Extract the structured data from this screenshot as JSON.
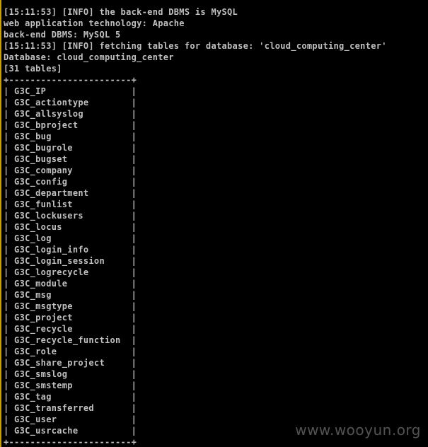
{
  "console": {
    "top_fragment": "---",
    "header_lines": [
      "[15:11:53] [INFO] the back-end DBMS is MySQL",
      "web application technology: Apache",
      "back-end DBMS: MySQL 5",
      "[15:11:53] [INFO] fetching tables for database: 'cloud_computing_center'",
      "Database: cloud_computing_center",
      "[31 tables]"
    ],
    "table_border": "+-----------------------+",
    "tables": [
      "| G3C_IP                |",
      "| G3C_actiontype        |",
      "| G3C_allsyslog         |",
      "| G3C_bproject          |",
      "| G3C_bug               |",
      "| G3C_bugrole           |",
      "| G3C_bugset            |",
      "| G3C_company           |",
      "| G3C_config            |",
      "| G3C_department        |",
      "| G3C_funlist           |",
      "| G3C_lockusers         |",
      "| G3C_locus             |",
      "| G3C_log               |",
      "| G3C_login_info        |",
      "| G3C_login_session     |",
      "| G3C_logrecycle        |",
      "| G3C_module            |",
      "| G3C_msg               |",
      "| G3C_msgtype           |",
      "| G3C_project           |",
      "| G3C_recycle           |",
      "| G3C_recycle_function  |",
      "| G3C_role              |",
      "| G3C_share_project     |",
      "| G3C_smslog            |",
      "| G3C_smstemp           |",
      "| G3C_tag               |",
      "| G3C_transferred       |",
      "| G3C_user              |",
      "| G3C_usrcache          |"
    ],
    "watermark": "www.wooyun.org"
  },
  "colors": {
    "background": "#000000",
    "text": "#c0c0c0",
    "left_bar": "#c8a000"
  }
}
